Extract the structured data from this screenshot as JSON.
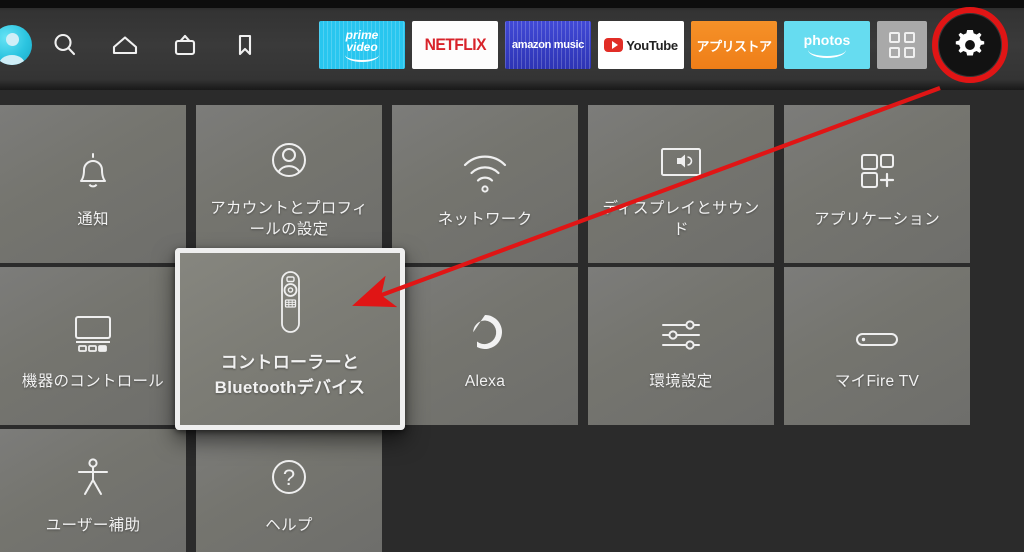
{
  "topbar": {
    "avatar": {
      "name": "profile-avatar"
    },
    "nav_icons": [
      {
        "id": "search",
        "label": "検索"
      },
      {
        "id": "home",
        "label": "ホーム"
      },
      {
        "id": "live-tv",
        "label": "ライブ"
      },
      {
        "id": "watchlist",
        "label": "ウォッチリスト"
      }
    ],
    "apps": [
      {
        "id": "prime-video",
        "line1": "prime",
        "line2": "video",
        "color": "#28c6ef"
      },
      {
        "id": "netflix",
        "label": "NETFLIX",
        "color": "#d8232a"
      },
      {
        "id": "amazon-music",
        "label": "amazon music",
        "color": "#3a41cc"
      },
      {
        "id": "youtube",
        "label": "YouTube",
        "color": "#e12d26"
      },
      {
        "id": "app-store",
        "label": "アプリストア",
        "color": "#f08520"
      },
      {
        "id": "photos",
        "label": "photos",
        "color": "#66dcf0"
      },
      {
        "id": "all-apps",
        "label": "",
        "color": "#a9a9a9"
      }
    ],
    "settings_button": {
      "label": "設定",
      "icon": "gear-icon",
      "highlight_color": "#e01515",
      "highlighted": true
    }
  },
  "settings_grid": {
    "rows": [
      [
        {
          "id": "notifications",
          "label": "通知",
          "icon": "bell-icon"
        },
        {
          "id": "account-profile",
          "label": "アカウントとプロフィールの設定",
          "icon": "person-icon"
        },
        {
          "id": "network",
          "label": "ネットワーク",
          "icon": "wifi-icon"
        },
        {
          "id": "display-sound",
          "label": "ディスプレイとサウンド",
          "icon": "display-sound-icon"
        },
        {
          "id": "applications",
          "label": "アプリケーション",
          "icon": "apps-plus-icon"
        }
      ],
      [
        {
          "id": "equipment-control",
          "label": "機器のコントロール",
          "icon": "tv-control-icon"
        },
        {
          "id": "controllers-bluetooth",
          "label": "コントローラーとBluetoothデバイス",
          "icon": "remote-icon",
          "focused": true
        },
        {
          "id": "alexa",
          "label": "Alexa",
          "icon": "alexa-ring-icon"
        },
        {
          "id": "preferences",
          "label": "環境設定",
          "icon": "sliders-icon"
        },
        {
          "id": "my-fire-tv",
          "label": "マイFire TV",
          "icon": "firetv-stick-icon"
        }
      ],
      [
        {
          "id": "accessibility",
          "label": "ユーザー補助",
          "icon": "accessibility-icon"
        },
        {
          "id": "help",
          "label": "ヘルプ",
          "icon": "question-circle-icon"
        }
      ]
    ]
  },
  "annotations": {
    "arrow": {
      "color": "#e01515",
      "from": "settings-gear",
      "to": "controllers-bluetooth-tile"
    },
    "ring": {
      "color": "#e01515",
      "target": "settings-gear"
    }
  }
}
